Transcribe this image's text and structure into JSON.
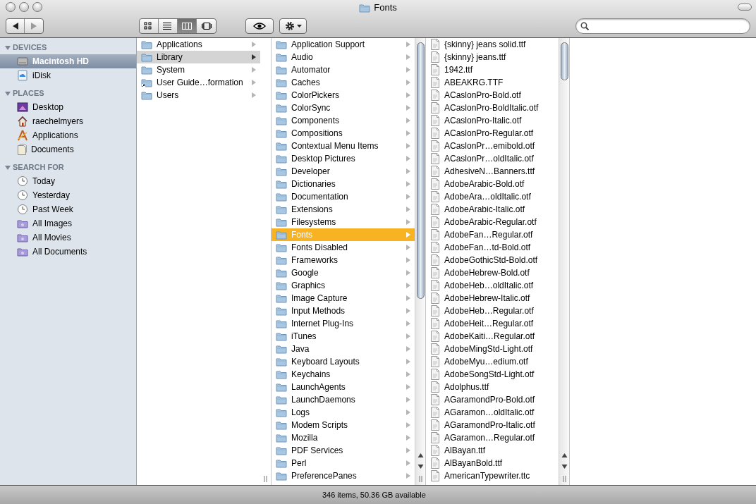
{
  "window": {
    "title": "Fonts"
  },
  "toolbar": {
    "nav": [
      {
        "kind": "back",
        "disabled": false
      },
      {
        "kind": "forward",
        "disabled": true
      }
    ],
    "view_buttons": [
      {
        "kind": "icons",
        "selected": false
      },
      {
        "kind": "list",
        "selected": false
      },
      {
        "kind": "columns",
        "selected": true
      },
      {
        "kind": "coverflow",
        "selected": false
      }
    ]
  },
  "sidebar": {
    "sections": [
      {
        "title": "DEVICES",
        "expanded": true,
        "items": [
          {
            "label": "Macintosh HD",
            "kind": "disk",
            "selected": true
          },
          {
            "label": "iDisk",
            "kind": "idisk",
            "selected": false
          }
        ]
      },
      {
        "title": "PLACES",
        "expanded": true,
        "items": [
          {
            "label": "Desktop",
            "kind": "desktop",
            "selected": false
          },
          {
            "label": "raechelmyers",
            "kind": "home",
            "selected": false
          },
          {
            "label": "Applications",
            "kind": "apps",
            "selected": false
          },
          {
            "label": "Documents",
            "kind": "documents",
            "selected": false
          }
        ]
      },
      {
        "title": "SEARCH FOR",
        "expanded": true,
        "items": [
          {
            "label": "Today",
            "kind": "clock",
            "selected": false
          },
          {
            "label": "Yesterday",
            "kind": "clock",
            "selected": false
          },
          {
            "label": "Past Week",
            "kind": "clock",
            "selected": false
          },
          {
            "label": "All Images",
            "kind": "smart",
            "selected": false
          },
          {
            "label": "All Movies",
            "kind": "smart",
            "selected": false
          },
          {
            "label": "All Documents",
            "kind": "smart",
            "selected": false
          }
        ]
      }
    ]
  },
  "columns": [
    {
      "focused": false,
      "items": [
        {
          "label": "Applications",
          "kind": "folder",
          "selected": false
        },
        {
          "label": "Library",
          "kind": "folder",
          "selected": true
        },
        {
          "label": "System",
          "kind": "folder",
          "selected": false
        },
        {
          "label": "User Guide…formation",
          "kind": "alias",
          "selected": false
        },
        {
          "label": "Users",
          "kind": "folder",
          "selected": false
        }
      ]
    },
    {
      "focused": true,
      "items": [
        {
          "label": "Application Support",
          "kind": "folder",
          "selected": false
        },
        {
          "label": "Audio",
          "kind": "folder",
          "selected": false
        },
        {
          "label": "Automator",
          "kind": "folder",
          "selected": false
        },
        {
          "label": "Caches",
          "kind": "folder",
          "selected": false
        },
        {
          "label": "ColorPickers",
          "kind": "folder",
          "selected": false
        },
        {
          "label": "ColorSync",
          "kind": "folder",
          "selected": false
        },
        {
          "label": "Components",
          "kind": "folder",
          "selected": false
        },
        {
          "label": "Compositions",
          "kind": "folder",
          "selected": false
        },
        {
          "label": "Contextual Menu Items",
          "kind": "folder",
          "selected": false
        },
        {
          "label": "Desktop Pictures",
          "kind": "folder",
          "selected": false
        },
        {
          "label": "Developer",
          "kind": "folder",
          "selected": false
        },
        {
          "label": "Dictionaries",
          "kind": "folder",
          "selected": false
        },
        {
          "label": "Documentation",
          "kind": "folder",
          "selected": false
        },
        {
          "label": "Extensions",
          "kind": "folder",
          "selected": false
        },
        {
          "label": "Filesystems",
          "kind": "folder",
          "selected": false
        },
        {
          "label": "Fonts",
          "kind": "folder",
          "selected": true
        },
        {
          "label": "Fonts Disabled",
          "kind": "folder",
          "selected": false
        },
        {
          "label": "Frameworks",
          "kind": "folder",
          "selected": false
        },
        {
          "label": "Google",
          "kind": "folder",
          "selected": false
        },
        {
          "label": "Graphics",
          "kind": "folder",
          "selected": false
        },
        {
          "label": "Image Capture",
          "kind": "folder",
          "selected": false
        },
        {
          "label": "Input Methods",
          "kind": "folder",
          "selected": false
        },
        {
          "label": "Internet Plug-Ins",
          "kind": "folder",
          "selected": false
        },
        {
          "label": "iTunes",
          "kind": "folder",
          "selected": false
        },
        {
          "label": "Java",
          "kind": "folder",
          "selected": false
        },
        {
          "label": "Keyboard Layouts",
          "kind": "folder",
          "selected": false
        },
        {
          "label": "Keychains",
          "kind": "folder",
          "selected": false
        },
        {
          "label": "LaunchAgents",
          "kind": "folder",
          "selected": false
        },
        {
          "label": "LaunchDaemons",
          "kind": "folder",
          "selected": false
        },
        {
          "label": "Logs",
          "kind": "folder",
          "selected": false
        },
        {
          "label": "Modem Scripts",
          "kind": "folder",
          "selected": false
        },
        {
          "label": "Mozilla",
          "kind": "folder",
          "selected": false
        },
        {
          "label": "PDF Services",
          "kind": "folder",
          "selected": false
        },
        {
          "label": "Perl",
          "kind": "folder",
          "selected": false
        },
        {
          "label": "PreferencePanes",
          "kind": "folder",
          "selected": false
        }
      ]
    },
    {
      "items": [
        {
          "label": "{skinny} jeans solid.ttf",
          "kind": "file",
          "selected": false
        },
        {
          "label": "{skinny} jeans.ttf",
          "kind": "file",
          "selected": false
        },
        {
          "label": "1942.ttf",
          "kind": "file",
          "selected": false
        },
        {
          "label": "ABEAKRG.TTF",
          "kind": "file",
          "selected": false
        },
        {
          "label": "ACaslonPro-Bold.otf",
          "kind": "file",
          "selected": false
        },
        {
          "label": "ACaslonPro-BoldItalic.otf",
          "kind": "file",
          "selected": false
        },
        {
          "label": "ACaslonPro-Italic.otf",
          "kind": "file",
          "selected": false
        },
        {
          "label": "ACaslonPro-Regular.otf",
          "kind": "file",
          "selected": false
        },
        {
          "label": "ACaslonPr…emibold.otf",
          "kind": "file",
          "selected": false
        },
        {
          "label": "ACaslonPr…oldItalic.otf",
          "kind": "file",
          "selected": false
        },
        {
          "label": "AdhesiveN…Banners.ttf",
          "kind": "file",
          "selected": false
        },
        {
          "label": "AdobeArabic-Bold.otf",
          "kind": "file",
          "selected": false
        },
        {
          "label": "AdobeAra…oldItalic.otf",
          "kind": "file",
          "selected": false
        },
        {
          "label": "AdobeArabic-Italic.otf",
          "kind": "file",
          "selected": false
        },
        {
          "label": "AdobeArabic-Regular.otf",
          "kind": "file",
          "selected": false
        },
        {
          "label": "AdobeFan…Regular.otf",
          "kind": "file",
          "selected": false
        },
        {
          "label": "AdobeFan…td-Bold.otf",
          "kind": "file",
          "selected": false
        },
        {
          "label": "AdobeGothicStd-Bold.otf",
          "kind": "file",
          "selected": false
        },
        {
          "label": "AdobeHebrew-Bold.otf",
          "kind": "file",
          "selected": false
        },
        {
          "label": "AdobeHeb…oldItalic.otf",
          "kind": "file",
          "selected": false
        },
        {
          "label": "AdobeHebrew-Italic.otf",
          "kind": "file",
          "selected": false
        },
        {
          "label": "AdobeHeb…Regular.otf",
          "kind": "file",
          "selected": false
        },
        {
          "label": "AdobeHeit…Regular.otf",
          "kind": "file",
          "selected": false
        },
        {
          "label": "AdobeKaiti…Regular.otf",
          "kind": "file",
          "selected": false
        },
        {
          "label": "AdobeMingStd-Light.otf",
          "kind": "file",
          "selected": false
        },
        {
          "label": "AdobeMyu…edium.otf",
          "kind": "file",
          "selected": false
        },
        {
          "label": "AdobeSongStd-Light.otf",
          "kind": "file",
          "selected": false
        },
        {
          "label": "Adolphus.ttf",
          "kind": "file",
          "selected": false
        },
        {
          "label": "AGaramondPro-Bold.otf",
          "kind": "file",
          "selected": false
        },
        {
          "label": "AGaramon…oldItalic.otf",
          "kind": "file",
          "selected": false
        },
        {
          "label": "AGaramondPro-Italic.otf",
          "kind": "file",
          "selected": false
        },
        {
          "label": "AGaramon…Regular.otf",
          "kind": "file",
          "selected": false
        },
        {
          "label": "AlBayan.ttf",
          "kind": "file",
          "selected": false
        },
        {
          "label": "AlBayanBold.ttf",
          "kind": "file",
          "selected": false
        },
        {
          "label": "AmericanTypewriter.ttc",
          "kind": "file",
          "selected": false
        }
      ]
    }
  ],
  "status_bar": {
    "text": "346 items, 50.36 GB available"
  }
}
